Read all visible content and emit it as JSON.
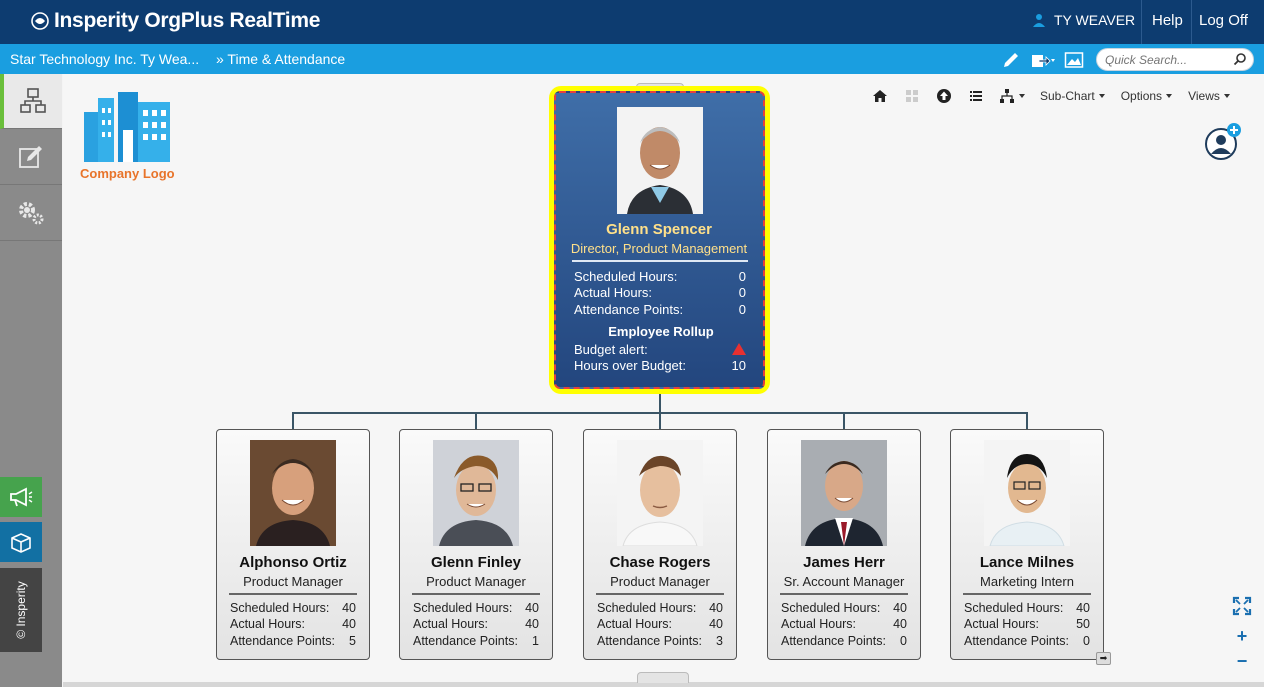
{
  "app": {
    "title": "Insperity OrgPlus RealTime"
  },
  "user": {
    "name": "TY WEAVER"
  },
  "top_links": {
    "help": "Help",
    "logoff": "Log Off"
  },
  "breadcrumb": {
    "item1": "Star Technology Inc. Ty Wea...",
    "item2": "» Time & Attendance"
  },
  "search": {
    "placeholder": "Quick Search..."
  },
  "company_logo": {
    "label": "Company Logo"
  },
  "sidebar": {
    "insperity_label": "© Insperity"
  },
  "toolbar": {
    "subchart": "Sub-Chart",
    "options": "Options",
    "views": "Views"
  },
  "colors": {
    "topbar": "#0d3c70",
    "navbar": "#1a9ee0",
    "highlight": "#ffff00",
    "card_name": "#ffe08a",
    "accent_green": "#6abf3b"
  },
  "top_card": {
    "name": "Glenn Spencer",
    "title": "Director, Product Management",
    "rows": [
      {
        "label": "Scheduled Hours:",
        "value": "0"
      },
      {
        "label": "Actual Hours:",
        "value": "0"
      },
      {
        "label": "Attendance Points:",
        "value": "0"
      }
    ],
    "rollup_heading": "Employee Rollup",
    "budget_alert_label": "Budget alert:",
    "budget_alert_icon": "warning-triangle-icon",
    "hours_over_label": "Hours over Budget:",
    "hours_over_value": "10"
  },
  "children": [
    {
      "name": "Alphonso Ortiz",
      "title": "Product Manager",
      "scheduled": "40",
      "actual": "40",
      "points": "5"
    },
    {
      "name": "Glenn Finley",
      "title": "Product Manager",
      "scheduled": "40",
      "actual": "40",
      "points": "1"
    },
    {
      "name": "Chase Rogers",
      "title": "Product Manager",
      "scheduled": "40",
      "actual": "40",
      "points": "3"
    },
    {
      "name": "James Herr",
      "title": "Sr. Account Manager",
      "scheduled": "40",
      "actual": "40",
      "points": "0"
    },
    {
      "name": "Lance Milnes",
      "title": "Marketing Intern",
      "scheduled": "40",
      "actual": "50",
      "points": "0"
    }
  ],
  "child_labels": {
    "scheduled": "Scheduled Hours:",
    "actual": "Actual Hours:",
    "points": "Attendance Points:"
  }
}
